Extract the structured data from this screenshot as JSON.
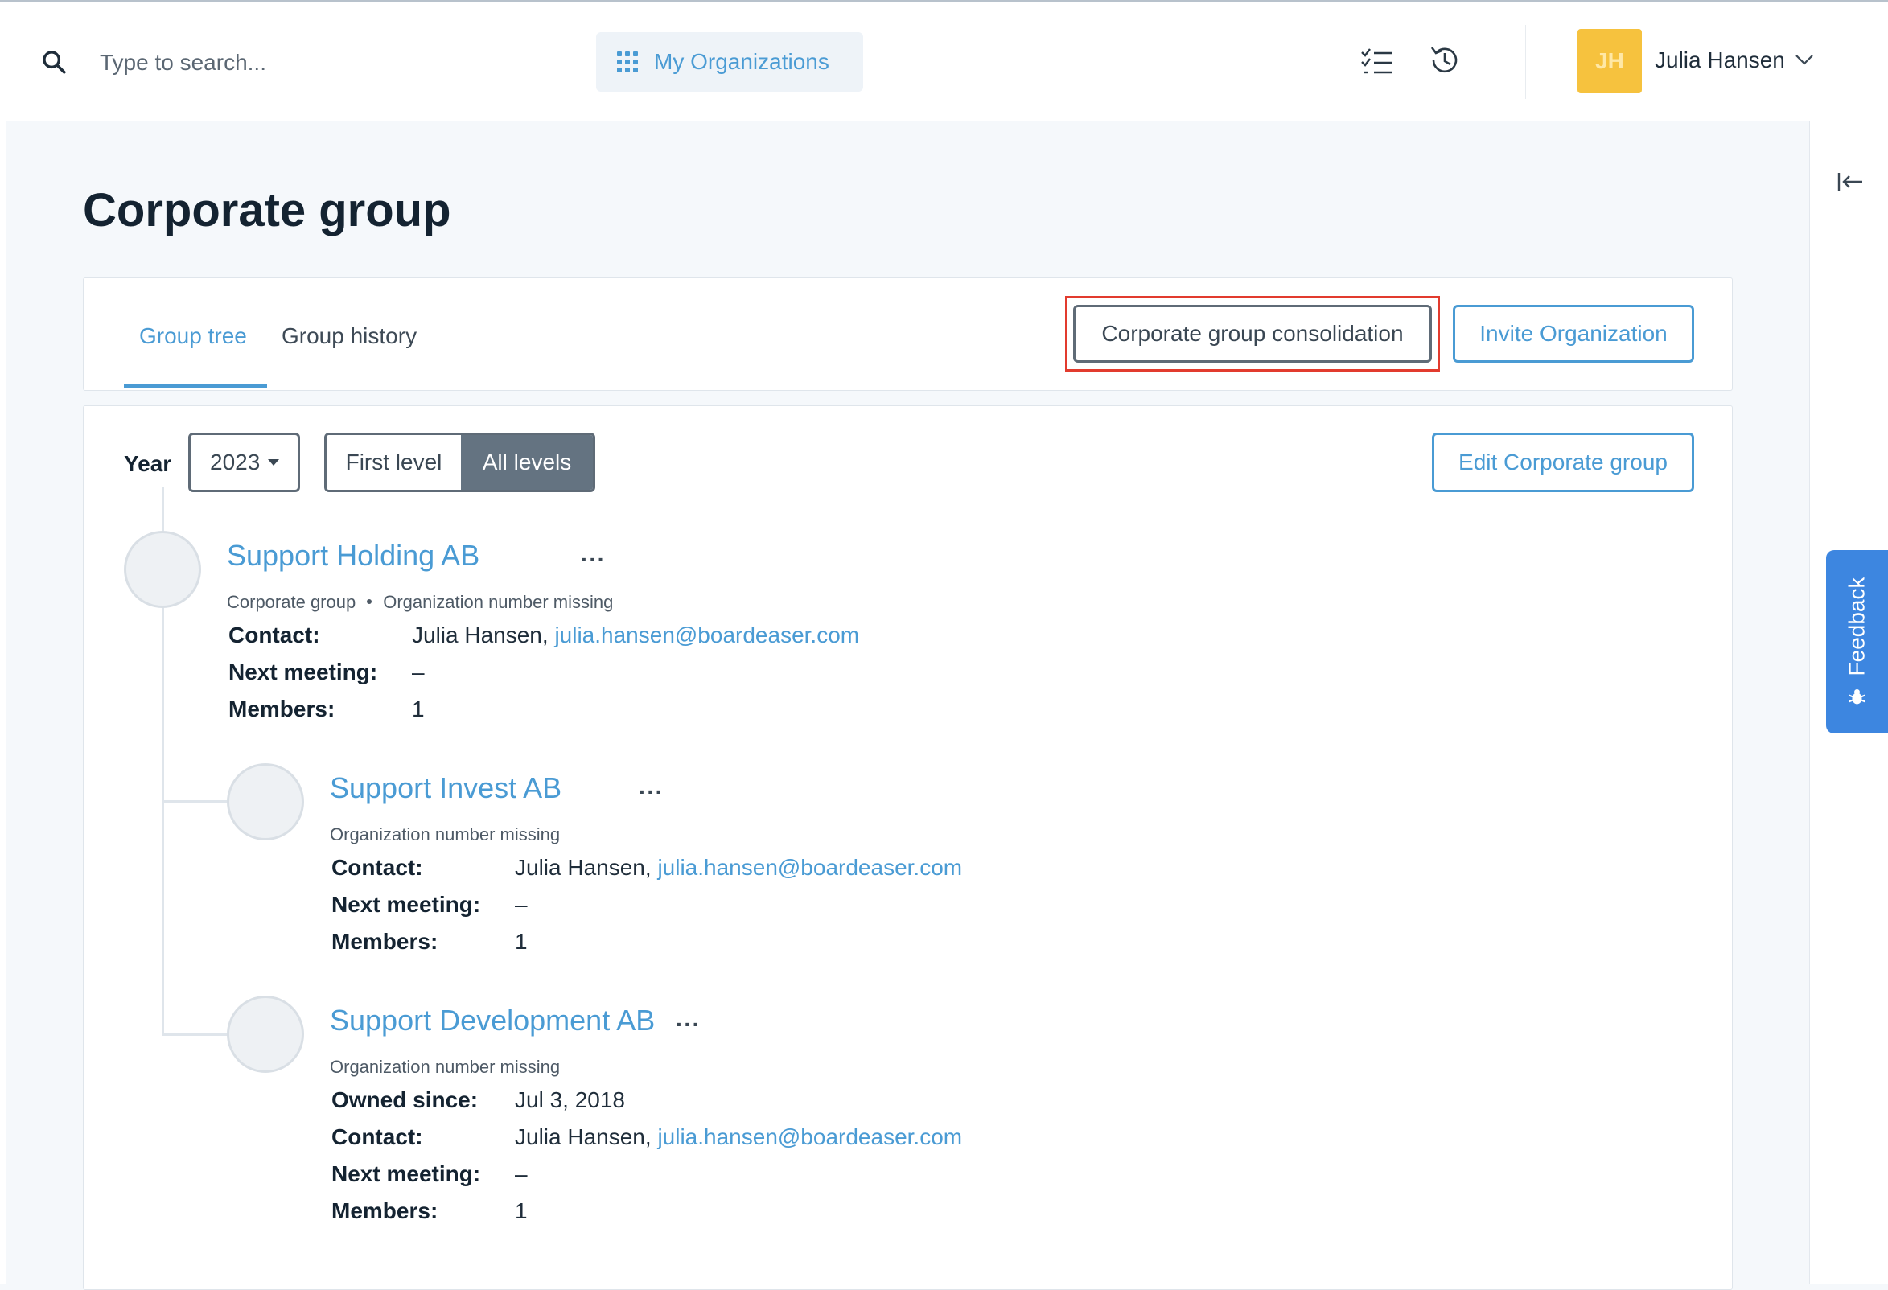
{
  "search": {
    "placeholder": "Type to search..."
  },
  "topbar": {
    "my_organizations_label": "My Organizations",
    "user_initials": "JH",
    "user_name": "Julia Hansen"
  },
  "feedback": {
    "label": "Feedback"
  },
  "page": {
    "title": "Corporate group"
  },
  "tabs": [
    {
      "label": "Group tree",
      "active": true
    },
    {
      "label": "Group history",
      "active": false
    }
  ],
  "actions": {
    "consolidation_label": "Corporate group consolidation",
    "invite_label": "Invite Organization",
    "edit_label": "Edit Corporate group"
  },
  "filters": {
    "year_label": "Year",
    "year_value": "2023",
    "levels": [
      {
        "label": "First level",
        "selected": false
      },
      {
        "label": "All levels",
        "selected": true
      }
    ]
  },
  "labels": {
    "contact": "Contact:",
    "next_meeting": "Next meeting:",
    "members": "Members:",
    "owned_since": "Owned since:",
    "more": "···"
  },
  "organizations": [
    {
      "name": "Support Holding AB",
      "tag": "Corporate group",
      "org_number": "Organization number missing",
      "contact_name": "Julia Hansen,",
      "contact_email": "julia.hansen@boardeaser.com",
      "next_meeting": "–",
      "members": "1"
    },
    {
      "name": "Support Invest AB",
      "org_number": "Organization number missing",
      "contact_name": "Julia Hansen,",
      "contact_email": "julia.hansen@boardeaser.com",
      "next_meeting": "–",
      "members": "1"
    },
    {
      "name": "Support Development AB",
      "org_number": "Organization number missing",
      "owned_since": "Jul 3, 2018",
      "contact_name": "Julia Hansen,",
      "contact_email": "julia.hansen@boardeaser.com",
      "next_meeting": "–",
      "members": "1"
    }
  ],
  "colors": {
    "accent": "#4a9bd4",
    "highlight": "#e23b2e",
    "avatar": "#f6c23e",
    "feedback": "#3d86e0",
    "segment_active": "#647381"
  }
}
